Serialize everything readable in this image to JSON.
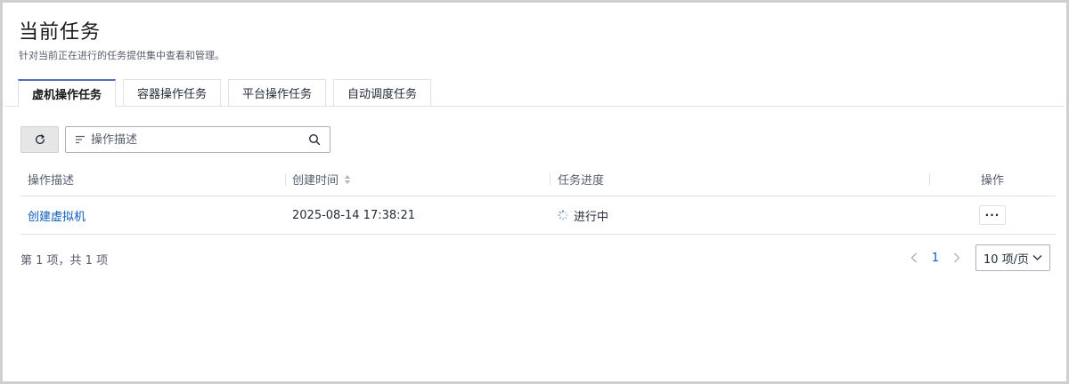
{
  "header": {
    "title": "当前任务",
    "subtitle": "针对当前正在进行的任务提供集中查看和管理。"
  },
  "tabs": [
    {
      "label": "虚机操作任务",
      "active": true
    },
    {
      "label": "容器操作任务",
      "active": false
    },
    {
      "label": "平台操作任务",
      "active": false
    },
    {
      "label": "自动调度任务",
      "active": false
    }
  ],
  "toolbar": {
    "refresh_icon": "refresh-icon",
    "search_placeholder": "操作描述",
    "search_value": ""
  },
  "table": {
    "columns": [
      "操作描述",
      "创建时间",
      "任务进度",
      "操作"
    ],
    "rows": [
      {
        "description": "创建虚拟机",
        "created_at": "2025-08-14 17:38:21",
        "progress": "进行中",
        "action": "···"
      }
    ]
  },
  "footer": {
    "summary": "第 1 项，共 1 项",
    "current_page": "1",
    "page_size": "10 项/页"
  },
  "colors": {
    "accent": "#526ecc",
    "link": "#0b5cbd",
    "border": "#dfe1e6"
  }
}
